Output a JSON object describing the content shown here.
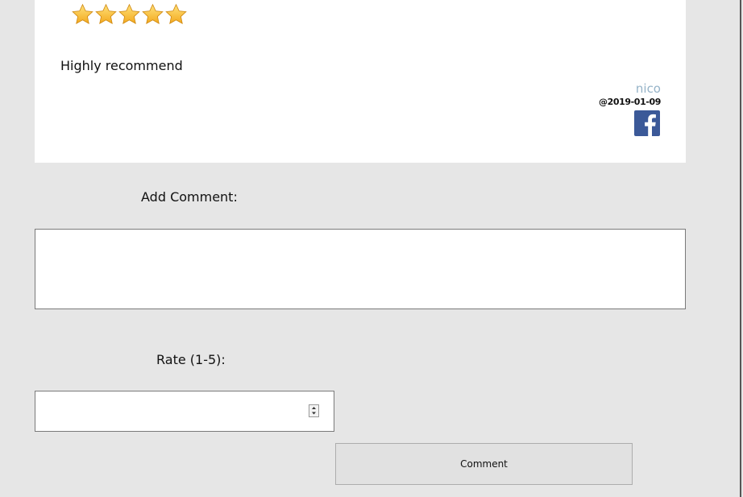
{
  "review": {
    "rating": 5,
    "rating_max": 5,
    "text": "Highly recommend",
    "author": "nico",
    "date": "@2019-01-09",
    "share_icon": "facebook-icon"
  },
  "form": {
    "comment_label": "Add Comment:",
    "comment_value": "",
    "rate_label": "Rate (1-5):",
    "rate_value": "",
    "submit_label": "Comment"
  },
  "colors": {
    "background": "#e6e6e6",
    "card": "#ffffff",
    "author": "#95b3c8",
    "facebook": "#3b5998",
    "star": "#f7b731",
    "button": "#e1e1e1"
  }
}
